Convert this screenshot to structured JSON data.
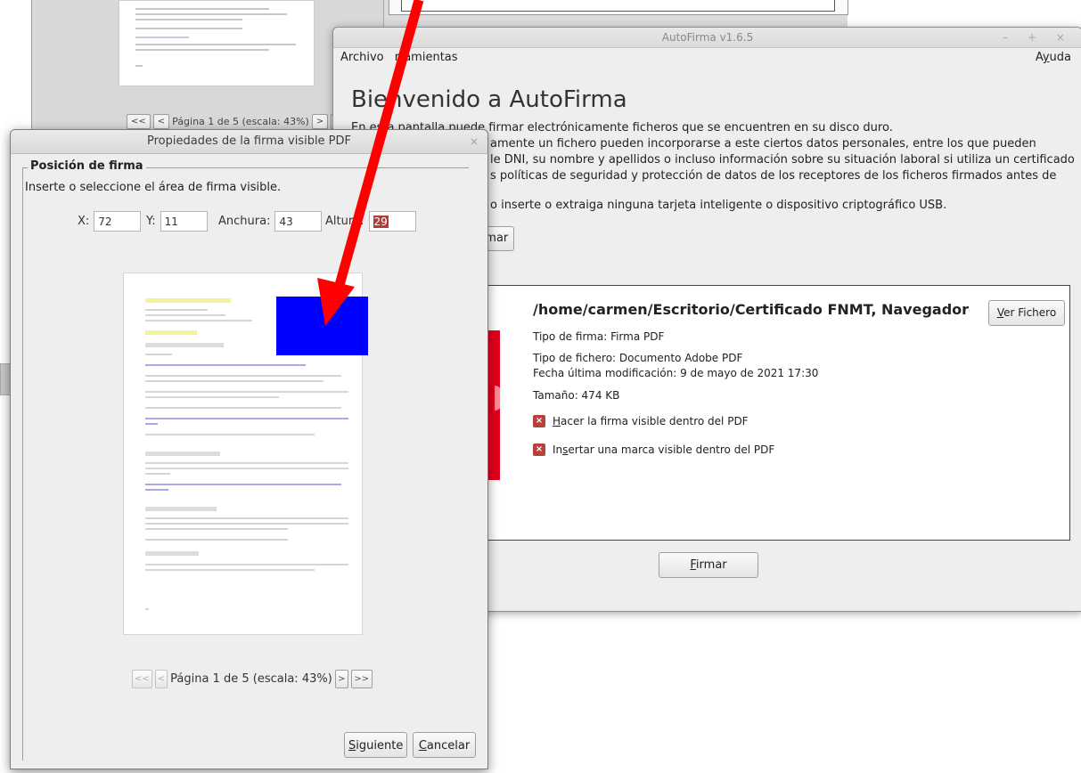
{
  "background_window": {
    "pager": {
      "first": "<<",
      "prev": "<",
      "label": "Página 1 de 5 (escala: 43%)",
      "next": ">",
      "last": ">>"
    }
  },
  "autofirma": {
    "title": "AutoFirma v1.6.5",
    "window_controls": "– + ×",
    "menu": {
      "archivo": "Archivo",
      "herramientas_rest": "rramientas",
      "ayuda_prefix": "A",
      "ayuda_underlined": "y",
      "ayuda_suffix": "uda"
    },
    "heading": "Bienvenido a AutoFirma",
    "desc_lines": [
      "En esta pantalla puede firmar electrónicamente ficheros que se encuentren en su disco duro.",
      "amente un fichero pueden incorporarse a este ciertos datos personales, entre los que pueden",
      "le DNI, su nombre y apellidos o incluso información sobre su situación laboral si utiliza un certificado",
      "s políticas de seguridad y protección de datos de los receptores de los ficheros firmados antes de"
    ],
    "warning": "o inserte o extraiga ninguna tarjeta inteligente o dispositivo criptográfico USB.",
    "top_button": "firmar",
    "file": {
      "path": "/home/carmen/Escritorio/Certificado FNMT, Navegadores ...",
      "view_button_first": "V",
      "view_button_rest": "er Fichero",
      "signature_type": "Tipo de firma: Firma PDF",
      "file_type": "Tipo de fichero: Documento Adobe PDF",
      "modified": "Fecha última modificación: 9 de mayo de 2021 17:30",
      "size": "Tamaño: 474 KB",
      "option1_first": "H",
      "option1_rest": "acer la firma visible dentro del PDF",
      "option2_a": "In",
      "option2_b": "s",
      "option2_c": "ertar una marca visible dentro del PDF",
      "check_glyph": "×"
    },
    "sign_button_first": "F",
    "sign_button_rest": "irmar"
  },
  "dialog": {
    "title": "Propiedades de la firma visible PDF",
    "close": "×",
    "group_label": "Posición de firma",
    "instructions": "Inserte o seleccione el área de firma visible.",
    "x_label": "X:",
    "x_value": "72",
    "y_label": "Y:",
    "y_value": "11",
    "width_label": "Anchura:",
    "width_value": "43",
    "height_label": "Altura:",
    "height_value": "29",
    "pager": {
      "first": "<<",
      "prev": "<",
      "label": "Página 1 de 5 (escala: 43%)",
      "next": ">",
      "last": ">>"
    },
    "next_first": "S",
    "next_rest": "iguiente",
    "cancel_first": "C",
    "cancel_rest": "ancelar"
  },
  "colors": {
    "selection_rect": "#0000ff",
    "arrow": "#ff0000",
    "autofirma_red": "#e4001b"
  }
}
